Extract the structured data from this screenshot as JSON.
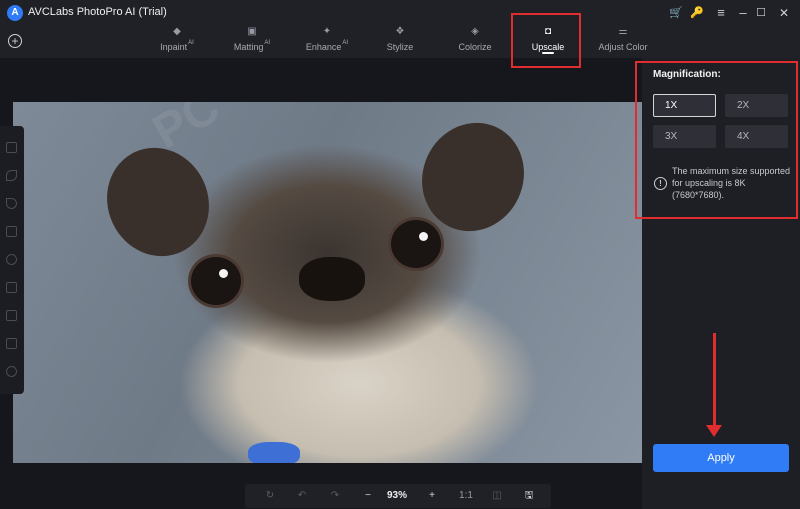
{
  "app": {
    "logo_glyph": "A",
    "title": "AVCLabs PhotoPro AI (Trial)"
  },
  "window_controls": {
    "cart": "🛒",
    "key": "🔑",
    "menu": "≡",
    "minimize": "–",
    "maximize": "☐",
    "close": "✕"
  },
  "toolbar": {
    "add_glyph": "+",
    "tabs": [
      {
        "label": "Inpaint",
        "badge": "AI",
        "icon": "inpaint-icon",
        "glyph": "◆"
      },
      {
        "label": "Matting",
        "badge": "AI",
        "icon": "matting-icon",
        "glyph": "▣"
      },
      {
        "label": "Enhance",
        "badge": "AI",
        "icon": "enhance-icon",
        "glyph": "✦"
      },
      {
        "label": "Stylize",
        "badge": "",
        "icon": "stylize-icon",
        "glyph": "❖"
      },
      {
        "label": "Colorize",
        "badge": "",
        "icon": "colorize-icon",
        "glyph": "◈"
      },
      {
        "label": "Upscale",
        "badge": "",
        "icon": "upscale-icon",
        "glyph": "◘"
      },
      {
        "label": "Adjust Color",
        "badge": "",
        "icon": "adjust-color-icon",
        "glyph": "⚌"
      }
    ],
    "active_tab": "Upscale"
  },
  "bottom_bar": {
    "rotate": "↻",
    "undo": "↶",
    "redo": "↷",
    "zoom_out": "−",
    "zoom_level": "93%",
    "zoom_in": "+",
    "actual_size": "1:1",
    "compare": "◫",
    "save": "🖫"
  },
  "panel": {
    "title": "Magnification:",
    "options": [
      "1X",
      "2X",
      "3X",
      "4X"
    ],
    "selected": "1X",
    "info_glyph": "!",
    "info": "The maximum size supported for upscaling is 8K (7680*7680).",
    "apply_label": "Apply"
  },
  "colors": {
    "accent": "#2f7cf6",
    "highlight": "#e02d2d",
    "background": "#16171c"
  }
}
